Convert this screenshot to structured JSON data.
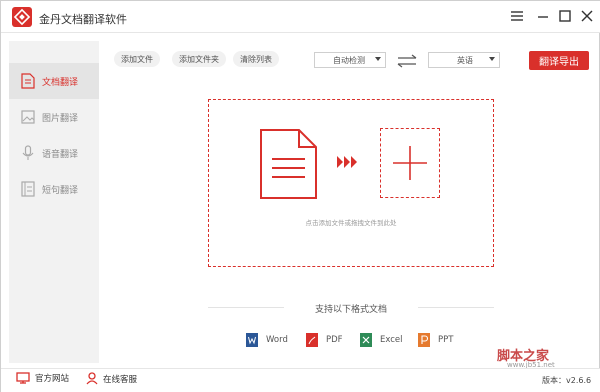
{
  "app": {
    "title": "金丹文档翻译软件"
  },
  "sidebar": {
    "items": [
      {
        "label": "文档翻译",
        "active": true,
        "icon": "document-icon"
      },
      {
        "label": "图片翻译",
        "active": false,
        "icon": "image-icon"
      },
      {
        "label": "语音翻译",
        "active": false,
        "icon": "microphone-icon"
      },
      {
        "label": "短句翻译",
        "active": false,
        "icon": "sentence-icon"
      }
    ]
  },
  "toolbar": {
    "add_file": "添加文件",
    "add_folder": "添加文件夹",
    "clear_list": "清除列表",
    "source_lang": "自动检测",
    "target_lang": "英语",
    "export": "翻译导出"
  },
  "dropzone": {
    "hint": "点击添加文件或拖拽文件到此处"
  },
  "formats": {
    "title": "支持以下格式文档",
    "items": [
      {
        "label": "Word",
        "icon": "word-icon",
        "color": "#2b5797"
      },
      {
        "label": "PDF",
        "icon": "pdf-icon",
        "color": "#d9302b"
      },
      {
        "label": "Excel",
        "icon": "excel-icon",
        "color": "#2e8b57"
      },
      {
        "label": "PPT",
        "icon": "ppt-icon",
        "color": "#e57a2f"
      }
    ]
  },
  "footer": {
    "website": "官方网站",
    "support": "在线客服",
    "version": "版本：v2.6.6"
  },
  "watermark": {
    "text": "脚本之家",
    "url": "www.jb51.net"
  },
  "colors": {
    "accent": "#d9302b"
  }
}
